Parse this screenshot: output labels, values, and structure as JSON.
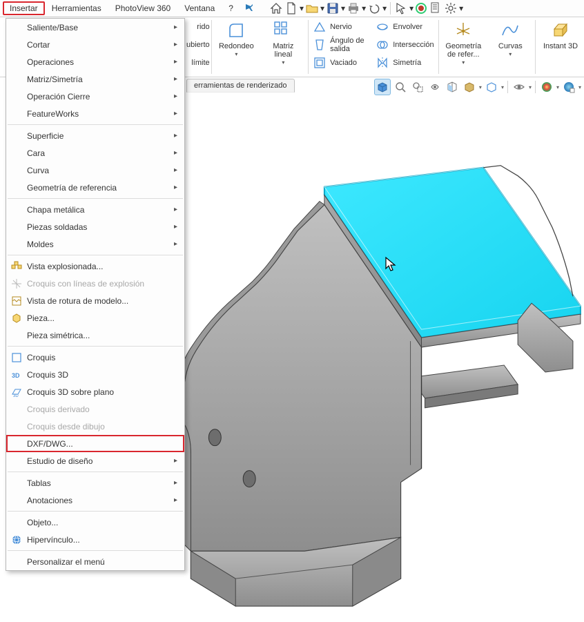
{
  "menubar": {
    "items": [
      "Insertar",
      "Herramientas",
      "PhotoView 360",
      "Ventana",
      "?"
    ],
    "selected": 0
  },
  "ribbon": {
    "hidden_col": [
      "rido",
      "ubierto",
      "límite"
    ],
    "big": [
      {
        "label": "Redondeo",
        "dd": true
      },
      {
        "label": "Matriz lineal",
        "dd": true
      }
    ],
    "col1": [
      {
        "label": "Nervio",
        "dd": false
      },
      {
        "label": "Ángulo de salida",
        "dd": false
      },
      {
        "label": "Vaciado",
        "dd": false
      }
    ],
    "col2": [
      {
        "label": "Envolver",
        "dd": false
      },
      {
        "label": "Intersección",
        "dd": false
      },
      {
        "label": "Simetría",
        "dd": false
      }
    ],
    "big2": [
      {
        "label": "Geometría de refer...",
        "dd": true
      },
      {
        "label": "Curvas",
        "dd": true
      },
      {
        "label": "Instant 3D",
        "dd": false
      }
    ]
  },
  "tab": {
    "label": "erramientas de renderizado"
  },
  "dropdown": {
    "g1": [
      {
        "label": "Saliente/Base",
        "arrow": true
      },
      {
        "label": "Cortar",
        "arrow": true
      },
      {
        "label": "Operaciones",
        "arrow": true
      },
      {
        "label": "Matriz/Simetría",
        "arrow": true
      },
      {
        "label": "Operación Cierre",
        "arrow": true
      },
      {
        "label": "FeatureWorks",
        "arrow": true
      }
    ],
    "g2": [
      {
        "label": "Superficie",
        "arrow": true
      },
      {
        "label": "Cara",
        "arrow": true
      },
      {
        "label": "Curva",
        "arrow": true
      },
      {
        "label": "Geometría de referencia",
        "arrow": true
      }
    ],
    "g3": [
      {
        "label": "Chapa metálica",
        "arrow": true
      },
      {
        "label": "Piezas soldadas",
        "arrow": true
      },
      {
        "label": "Moldes",
        "arrow": true
      }
    ],
    "g4": [
      {
        "label": "Vista explosionada...",
        "icon": "explode"
      },
      {
        "label": "Croquis con líneas de explosión",
        "icon": "explode-lines",
        "disabled": true
      },
      {
        "label": "Vista de rotura de modelo...",
        "icon": "break-view"
      },
      {
        "label": "Pieza...",
        "icon": "part"
      },
      {
        "label": "Pieza simétrica..."
      }
    ],
    "g5": [
      {
        "label": "Croquis",
        "icon": "sketch"
      },
      {
        "label": "Croquis 3D",
        "icon": "sketch3d"
      },
      {
        "label": "Croquis 3D sobre plano",
        "icon": "sketch3d-plane"
      },
      {
        "label": "Croquis derivado",
        "disabled": true
      },
      {
        "label": "Croquis desde dibujo",
        "disabled": true
      },
      {
        "label": "DXF/DWG...",
        "highlight": true
      },
      {
        "label": "Estudio de diseño",
        "arrow": true
      }
    ],
    "g6": [
      {
        "label": "Tablas",
        "arrow": true
      },
      {
        "label": "Anotaciones",
        "arrow": true
      }
    ],
    "g7": [
      {
        "label": "Objeto..."
      },
      {
        "label": "Hipervínculo...",
        "icon": "hyperlink"
      }
    ],
    "g8": [
      {
        "label": "Personalizar el menú"
      }
    ]
  }
}
